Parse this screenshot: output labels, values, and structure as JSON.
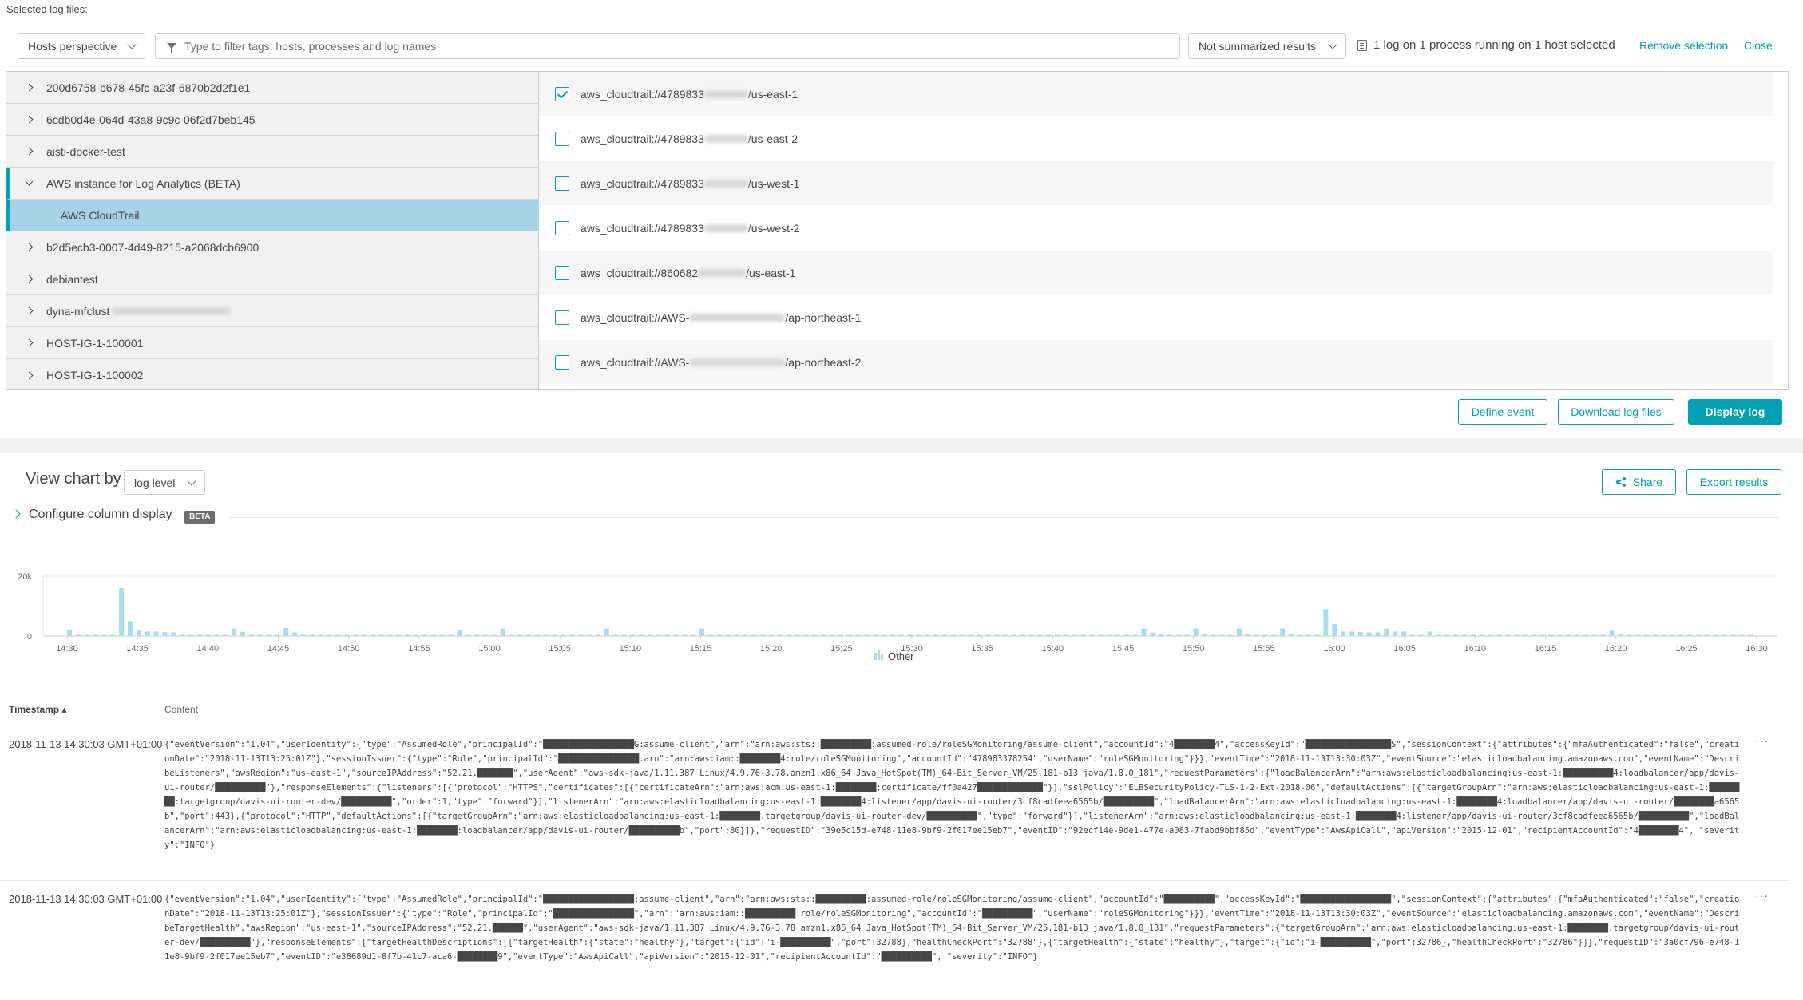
{
  "selected_label": "Selected log files:",
  "perspective_dropdown": "Hosts perspective",
  "filter_placeholder": "Type to filter tags, hosts, processes and log names",
  "summary_dropdown": "Not summarized results",
  "log_status": "1 log on 1 process running on 1 host selected",
  "remove_selection": "Remove selection",
  "close": "Close",
  "hosts": [
    {
      "label": "200d6758-b678-45fc-a23f-6870b2d2f1e1"
    },
    {
      "label": "6cdb0d4e-064d-43a8-9c9c-06f2d7beb145"
    },
    {
      "label": "aisti-docker-test"
    },
    {
      "label": "AWS instance for Log Analytics (BETA)"
    },
    {
      "label": "AWS CloudTrail"
    },
    {
      "label": "b2d5ecb3-0007-4d49-8215-a2068dcb6900"
    },
    {
      "label": "debiantest"
    },
    {
      "label": "dyna-mfclust"
    },
    {
      "label": "HOST-IG-1-100001"
    },
    {
      "label": "HOST-IG-1-100002"
    }
  ],
  "logs": [
    {
      "prefix": "aws_cloudtrail://4789833",
      "suffix": "/us-east-1",
      "checked": true
    },
    {
      "prefix": "aws_cloudtrail://4789833",
      "suffix": "/us-east-2",
      "checked": false
    },
    {
      "prefix": "aws_cloudtrail://4789833",
      "suffix": "/us-west-1",
      "checked": false
    },
    {
      "prefix": "aws_cloudtrail://4789833",
      "suffix": "/us-west-2",
      "checked": false
    },
    {
      "prefix": "aws_cloudtrail://860682",
      "suffix": "/us-east-1",
      "checked": false
    },
    {
      "prefix": "aws_cloudtrail://AWS-",
      "suffix": "/ap-northeast-1",
      "checked": false
    },
    {
      "prefix": "aws_cloudtrail://AWS-",
      "suffix": "/ap-northeast-2",
      "checked": false
    }
  ],
  "buttons": {
    "define_event": "Define event",
    "download_logs": "Download log files",
    "display_log": "Display log",
    "share": "Share",
    "export": "Export results"
  },
  "view_chart_by": "View chart by",
  "chart_by_dropdown": "log level",
  "configure_columns": "Configure column display",
  "beta": "BETA",
  "chart_data": {
    "type": "bar",
    "y_ticks": [
      "20k",
      "0"
    ],
    "ylim": [
      0,
      20000
    ],
    "x_ticks": [
      "14:30",
      "14:35",
      "14:40",
      "14:45",
      "14:50",
      "14:55",
      "15:00",
      "15:05",
      "15:10",
      "15:15",
      "15:20",
      "15:25",
      "15:30",
      "15:35",
      "15:40",
      "15:45",
      "15:50",
      "15:55",
      "16:00",
      "16:05",
      "16:10",
      "16:15",
      "16:20",
      "16:25",
      "16:30"
    ],
    "series": [
      {
        "name": "Other",
        "color": "#a9dcef"
      }
    ],
    "values": [
      2000,
      300,
      200,
      300,
      200,
      200,
      16000,
      5000,
      1800,
      1500,
      1500,
      1300,
      1200,
      200,
      300,
      200,
      200,
      200,
      200,
      2500,
      1400,
      400,
      200,
      200,
      200,
      2700,
      1200,
      300,
      200,
      200,
      200,
      200,
      200,
      200,
      200,
      200,
      200,
      200,
      200,
      200,
      200,
      200,
      200,
      200,
      200,
      2000,
      400,
      200,
      200,
      200,
      2500,
      300,
      200,
      200,
      200,
      200,
      200,
      200,
      200,
      200,
      200,
      200,
      2500,
      200,
      200,
      200,
      200,
      200,
      200,
      200,
      200,
      200,
      200,
      2500,
      200,
      200,
      200,
      200,
      200,
      200,
      200,
      200,
      200,
      200,
      200,
      200,
      200,
      200,
      200,
      200,
      200,
      200,
      200,
      200,
      200,
      200,
      200,
      200,
      200,
      200,
      200,
      200,
      200,
      200,
      200,
      200,
      200,
      200,
      200,
      200,
      200,
      200,
      200,
      200,
      200,
      200,
      200,
      200,
      200,
      200,
      200,
      200,
      200,
      200,
      2500,
      1200,
      600,
      200,
      200,
      200,
      2500,
      600,
      200,
      200,
      200,
      2500,
      600,
      200,
      200,
      200,
      2500,
      600,
      200,
      200,
      200,
      9000,
      4000,
      1500,
      1500,
      1300,
      1200,
      1200,
      2500,
      1500,
      1500,
      200,
      200,
      1500,
      200,
      200,
      200,
      200,
      200,
      200,
      200,
      200,
      200,
      200,
      200,
      200,
      200,
      200,
      200,
      200,
      200,
      200,
      200,
      200,
      1800,
      600,
      200,
      200,
      200,
      200,
      200,
      200,
      200,
      200,
      200,
      200,
      200,
      200,
      200,
      200,
      200
    ]
  },
  "table": {
    "col_timestamp": "Timestamp",
    "col_content": "Content",
    "rows": [
      {
        "timestamp": "2018-11-13 14:30:03 GMT+01:00",
        "content": "{\"eventVersion\":\"1.04\",\"userIdentity\":{\"type\":\"AssumedRole\",\"principalId\":\"██████████████████G:assume-client\",\"arn\":\"arn:aws:sts::██████████:assumed-role/roleSGMonitoring/assume-client\",\"accountId\":\"4████████4\",\"accessKeyId\":\"█████████████████S\",\"sessionContext\":{\"attributes\":{\"mfaAuthenticated\":\"false\",\"creationDate\":\"2018-11-13T13:25:01Z\"},\"sessionIssuer\":{\"type\":\"Role\",\"principalId\":\"████████████████.arn\":\"arn:aws:iam::████████4:role/roleSGMonitoring\",\"accountId\":\"478983378254\",\"userName\":\"roleSGMonitoring\"}}},\"eventTime\":\"2018-11-13T13:30:03Z\",\"eventSource\":\"elasticloadbalancing.amazonaws.com\",\"eventName\":\"DescribeListeners\",\"awsRegion\":\"us-east-1\",\"sourceIPAddress\":\"52.21.███████\",\"userAgent\":\"aws-sdk-java/1.11.387 Linux/4.9.76-3.78.amzn1.x86_64 Java_HotSpot(TM)_64-Bit_Server_VM/25.181-b13 java/1.8.0_181\",\"requestParameters\":{\"loadBalancerArn\":\"arn:aws:elasticloadbalancing:us-east-1:██████████4:loadbalancer/app/davis-ui-router/██████████\"},\"responseElements\":{\"listeners\":[{\"protocol\":\"HTTPS\",\"certificates\":[{\"certificateArn\":\"arn:aws:acm:us-east-1:████████:certificate/ff0a427█████████████\"}],\"sslPolicy\":\"ELBSecurityPolicy-TLS-1-2-Ext-2018-06\",\"defaultActions\":[{\"targetGroupArn\":\"arn:aws:elasticloadbalancing:us-east-1:████████:targetgroup/davis-ui-router-dev/██████████\",\"order\":1,\"type\":\"forward\"}],\"listenerArn\":\"arn:aws:elasticloadbalancing:us-east-1:████████4:listener/app/davis-ui-router/3cf8cadfeea6565b/██████████\",\"loadBalancerArn\":\"arn:aws:elasticloadbalancing:us-east-1:████████4:loadbalancer/app/davis-ui-router/████████a6565b\",\"port\":443},{\"protocol\":\"HTTP\",\"defaultActions\":[{\"targetGroupArn\":\"arn:aws:elasticloadbalancing:us-east-1:████████.targetgroup/davis-ui-router-dev/██████████\",\"type\":\"forward\"}],\"listenerArn\":\"arn:aws:elasticloadbalancing:us-east-1:████████4:listener/app/davis-ui-router/3cf8cadfeea6565b/██████████\",\"loadBalancerArn\":\"arn:aws:elasticloadbalancing:us-east-1:████████:loadbalancer/app/davis-ui-router/██████████b\",\"port\":80}]},\"requestID\":\"39e5c15d-e748-11e8-9bf9-2f017ee15eb7\",\"eventID\":\"92ecf14e-9de1-477e-a083-7fabd9bbf85d\",\"eventType\":\"AwsApiCall\",\"apiVersion\":\"2015-12-01\",\"recipientAccountId\":\"4████████4\", \"severity\":\"INFO\"}"
      },
      {
        "timestamp": "2018-11-13 14:30:03 GMT+01:00",
        "content": "{\"eventVersion\":\"1.04\",\"userIdentity\":{\"type\":\"AssumedRole\",\"principalId\":\"██████████████████:assume-client\",\"arn\":\"arn:aws:sts::██████████:assumed-role/roleSGMonitoring/assume-client\",\"accountId\":\"██████████\",\"accessKeyId\":\"██████████████████\",\"sessionContext\":{\"attributes\":{\"mfaAuthenticated\":\"false\",\"creationDate\":\"2018-11-13T13:25:01Z\"},\"sessionIssuer\":{\"type\":\"Role\",\"principalId\":\"████████████████\",\"arn\":\"arn:aws:iam::██████████:role/roleSGMonitoring\",\"accountId\":\"██████████\",\"userName\":\"roleSGMonitoring\"}}},\"eventTime\":\"2018-11-13T13:30:03Z\",\"eventSource\":\"elasticloadbalancing.amazonaws.com\",\"eventName\":\"DescribeTargetHealth\",\"awsRegion\":\"us-east-1\",\"sourceIPAddress\":\"52.21.██████\",\"userAgent\":\"aws-sdk-java/1.11.387 Linux/4.9.76-3.78.amzn1.x86_64 Java_HotSpot(TM)_64-Bit_Server_VM/25.181-b13 java/1.8.0_181\",\"requestParameters\":{\"targetGroupArn\":\"arn:aws:elasticloadbalancing:us-east-1:████████:targetgroup/davis-ui-router-dev/██████████\"},\"responseElements\":{\"targetHealthDescriptions\":[{\"targetHealth\":{\"state\":\"healthy\"},\"target\":{\"id\":\"i-██████████\",\"port\":32788},\"healthCheckPort\":\"32788\"},{\"targetHealth\":{\"state\":\"healthy\"},\"target\":{\"id\":\"i-██████████\",\"port\":32786},\"healthCheckPort\":\"32786\"}]},\"requestID\":\"3a0cf796-e748-11e8-9bf9-2f017ee15eb7\",\"eventID\":\"e38689d1-8f7b-41c7-aca6-████████9\",\"eventType\":\"AwsApiCall\",\"apiVersion\":\"2015-12-01\",\"recipientAccountId\":\"██████████\", \"severity\":\"INFO\"}"
      }
    ]
  }
}
